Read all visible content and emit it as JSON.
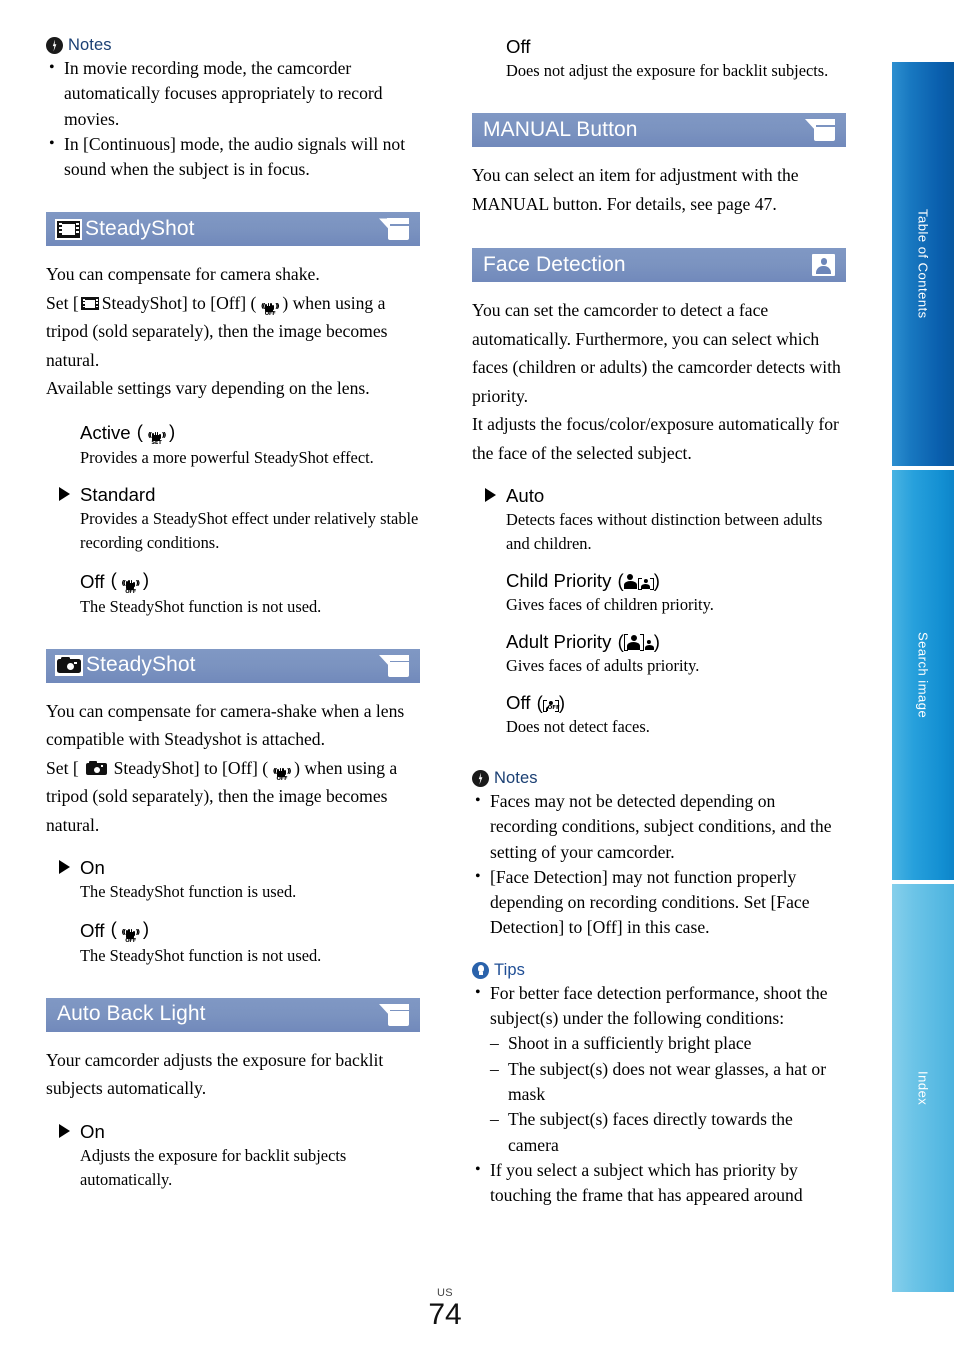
{
  "document": {
    "page_number": "74",
    "region_code": "US"
  },
  "left_column": {
    "notes_heading": "Notes",
    "notes": [
      "In movie recording mode, the camcorder automatically focuses appropriately to record movies.",
      "In [Continuous] mode, the audio signals will not sound when the subject is in focus."
    ],
    "sections": [
      {
        "title": "SteadyShot",
        "lead_icon": "film-icon",
        "trail_icon": "camcorder-icon",
        "body": [
          "You can compensate for camera shake.",
          "Set [  SteadyShot] to [Off] ( ) when using a tripod (sold separately), then the image becomes natural.",
          "Available settings vary depending on the lens."
        ],
        "body_line1": "You can compensate for camera shake.",
        "body_set_pre": "Set [",
        "body_set_mid": "SteadyShot] to [Off] (",
        "body_set_post": ") when using a tripod (sold separately), then the image becomes natural.",
        "body_line3": "Available settings vary depending on the lens.",
        "options": [
          {
            "label": "Active",
            "icon": "steadyshot-active-icon",
            "icon_badge": "SET",
            "default": false,
            "desc": "Provides a more powerful SteadyShot effect."
          },
          {
            "label": "Standard",
            "icon": null,
            "default": true,
            "desc": "Provides a SteadyShot effect under relatively stable recording conditions."
          },
          {
            "label": "Off",
            "icon": "steadyshot-off-icon",
            "icon_badge": "OFF",
            "default": false,
            "desc": "The SteadyShot function is not used."
          }
        ]
      },
      {
        "title": "SteadyShot",
        "lead_icon": "photo-camera-icon",
        "trail_icon": "camcorder-icon",
        "body_line1": "You can compensate for camera-shake when a lens compatible with Steadyshot is attached.",
        "body_set_pre": "Set [",
        "body_set_mid": "SteadyShot] to [Off] (",
        "body_set_post": ") when using a tripod (sold separately), then the image becomes natural.",
        "options": [
          {
            "label": "On",
            "icon": null,
            "default": true,
            "desc": "The SteadyShot function is used."
          },
          {
            "label": "Off",
            "icon": "steadyshot-off-icon",
            "icon_badge": "OFF",
            "default": false,
            "desc": "The SteadyShot function is not used."
          }
        ]
      },
      {
        "title": "Auto Back Light",
        "lead_icon": null,
        "trail_icon": "camcorder-icon",
        "body_line1": "Your camcorder adjusts the exposure for backlit subjects automatically.",
        "options": [
          {
            "label": "On",
            "icon": null,
            "default": true,
            "desc": "Adjusts the exposure for backlit subjects automatically."
          }
        ]
      }
    ]
  },
  "right_column": {
    "continued_option": {
      "label": "Off",
      "desc": "Does not adjust the exposure for backlit subjects."
    },
    "sections": [
      {
        "title": "MANUAL Button",
        "trail_icon": "camcorder-icon",
        "body_line1": "You can select an item for adjustment with the MANUAL button. For details, see page 47."
      },
      {
        "title": "Face Detection",
        "trail_icon": "face-icon",
        "body_line1": "You can set the camcorder to detect a face automatically. Furthermore, you can select which faces (children or adults) the camcorder detects with priority.",
        "body_line2": "It adjusts the focus/color/exposure automatically for the face of the selected subject.",
        "options": [
          {
            "label": "Auto",
            "icon": null,
            "default": true,
            "desc": "Detects faces without distinction between adults and children."
          },
          {
            "label": "Child Priority",
            "icon": "child-priority-icon",
            "default": false,
            "desc": "Gives faces of children priority."
          },
          {
            "label": "Adult Priority",
            "icon": "adult-priority-icon",
            "default": false,
            "desc": "Gives faces of adults priority."
          },
          {
            "label": "Off",
            "icon": "face-detection-off-icon",
            "icon_badge": "OFF",
            "default": false,
            "desc": "Does not detect faces."
          }
        ]
      }
    ],
    "notes_heading": "Notes",
    "notes": [
      "Faces may not be detected depending on recording conditions, subject conditions, and the setting of your camcorder.",
      "[Face Detection] may not function properly depending on recording conditions. Set [Face Detection] to [Off] in this case."
    ],
    "tips_heading": "Tips",
    "tips": [
      {
        "text": "For better face detection performance, shoot the subject(s) under the following conditions:",
        "sub": [
          "Shoot in a sufficiently bright place",
          "The subject(s) does not wear glasses, a hat or mask",
          "The subject(s) faces directly towards the camera"
        ]
      },
      {
        "text": "If you select a subject which has priority by touching the frame that has appeared around",
        "sub": []
      }
    ]
  },
  "side_tabs": [
    {
      "label": "Table of Contents",
      "color": "#0a5fae"
    },
    {
      "label": "Search image",
      "color": "#138fd2"
    },
    {
      "label": "Index",
      "color": "#55b8e2"
    }
  ]
}
